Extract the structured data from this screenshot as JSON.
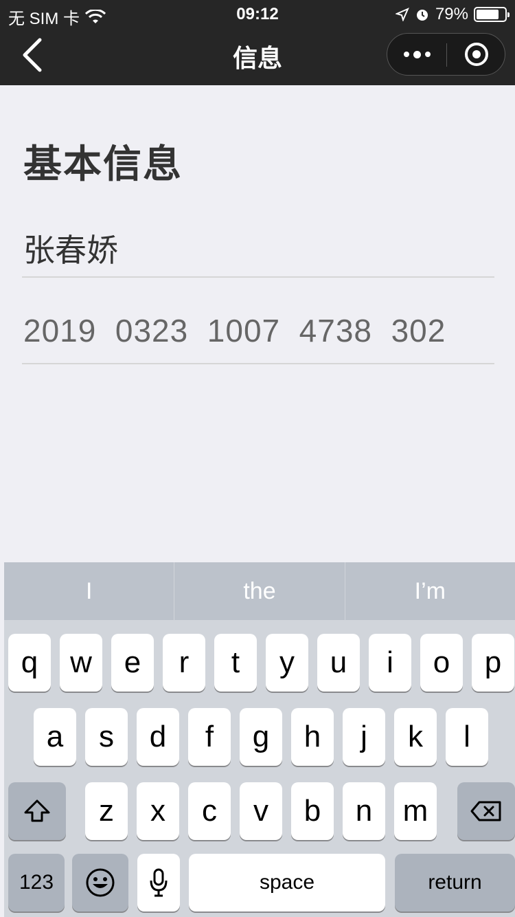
{
  "status_bar": {
    "carrier": "无 SIM 卡",
    "time": "09:12",
    "battery": "79%",
    "battery_level": 0.79
  },
  "nav": {
    "title": "信息"
  },
  "content": {
    "section_title": "基本信息",
    "name_value": "张春娇",
    "number_value": "2019  0323  1007  4738  302"
  },
  "keyboard": {
    "suggestions": [
      "I",
      "the",
      "I’m"
    ],
    "row1": [
      "q",
      "w",
      "e",
      "r",
      "t",
      "y",
      "u",
      "i",
      "o",
      "p"
    ],
    "row2": [
      "a",
      "s",
      "d",
      "f",
      "g",
      "h",
      "j",
      "k",
      "l"
    ],
    "row3": [
      "z",
      "x",
      "c",
      "v",
      "b",
      "n",
      "m"
    ],
    "numbers_label": "123",
    "space_label": "space",
    "return_label": "return"
  }
}
